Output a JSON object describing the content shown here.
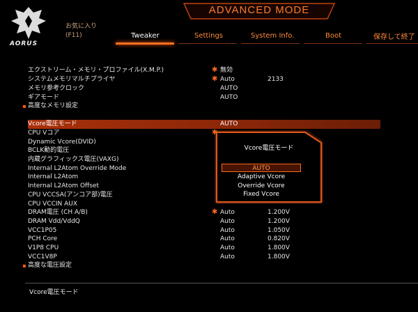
{
  "brand": {
    "logo_text": "AORUS"
  },
  "header": {
    "title": "ADVANCED MODE"
  },
  "favorites": {
    "label": "お気に入り",
    "key": "(F11)"
  },
  "tabs": [
    {
      "label": "Tweaker",
      "active": true
    },
    {
      "label": "Settings",
      "active": false
    },
    {
      "label": "System Info.",
      "active": false
    },
    {
      "label": "Boot",
      "active": false
    }
  ],
  "save_exit": "保存して終了",
  "memory_rows": [
    {
      "label": "エクストリーム・メモリ・プロファイル(X.M.P.)",
      "star": true,
      "value": "無効",
      "value2": ""
    },
    {
      "label": "システムメモリマルチプライヤ",
      "star": true,
      "value": "Auto",
      "value2": "2133"
    },
    {
      "label": "メモリ参考クロック",
      "star": false,
      "value": "AUTO",
      "value2": ""
    },
    {
      "label": "ギアモード",
      "star": false,
      "value": "AUTO",
      "value2": ""
    },
    {
      "label": "高度なメモリ設定",
      "submenu": true
    }
  ],
  "voltage_rows": [
    {
      "label": "Vcore電圧モード",
      "star": false,
      "value": "AUTO",
      "value2": "",
      "selected": true
    },
    {
      "label": "CPU Vコア",
      "star": true,
      "value": "",
      "value2": ""
    },
    {
      "label": "Dynamic Vcore(DVID)",
      "star": false,
      "value": "",
      "value2": ""
    },
    {
      "label": "BCLK動的電圧",
      "star": false,
      "value": "",
      "value2": ""
    },
    {
      "label": "内蔵グラフィックス電圧(VAXG)",
      "star": false,
      "value": "",
      "value2": ""
    },
    {
      "label": "Internal L2Atom Override Mode",
      "star": false,
      "value": "",
      "value2": ""
    },
    {
      "label": "Internal L2Atom",
      "star": false,
      "value": "",
      "value2": ""
    },
    {
      "label": "Internal L2Atom Offset",
      "star": false,
      "value": "",
      "value2": ""
    },
    {
      "label": "CPU VCCSA(アンコア部)電圧",
      "star": false,
      "value": "",
      "value2": ""
    },
    {
      "label": "CPU VCCIN AUX",
      "star": false,
      "value": "",
      "value2": ""
    },
    {
      "label": "DRAM電圧 (CH A/B)",
      "star": true,
      "value": "Auto",
      "value2": "1.200V"
    },
    {
      "label": "DRAM Vdd/VddQ",
      "star": false,
      "value": "Auto",
      "value2": "1.200V"
    },
    {
      "label": "VCC1P05",
      "star": false,
      "value": "Auto",
      "value2": "1.050V"
    },
    {
      "label": "PCH Core",
      "star": false,
      "value": "Auto",
      "value2": "0.820V"
    },
    {
      "label": "V1P8 CPU",
      "star": false,
      "value": "Auto",
      "value2": "1.800V"
    },
    {
      "label": "VCC1V8P",
      "star": false,
      "value": "Auto",
      "value2": "1.800V"
    },
    {
      "label": "高度な電圧設定",
      "submenu": true
    }
  ],
  "popup": {
    "title": "Vcore電圧モード",
    "options": [
      {
        "label": "AUTO",
        "selected": true
      },
      {
        "label": "Adaptive Vcore",
        "selected": false
      },
      {
        "label": "Override Vcore",
        "selected": false
      },
      {
        "label": "Fixed Vcore",
        "selected": false
      }
    ]
  },
  "help": {
    "text": "Vcore電圧モード"
  },
  "colors": {
    "accent": "#ff6a20",
    "selected_row": "#a8310b",
    "title": "#ff7a2a"
  }
}
